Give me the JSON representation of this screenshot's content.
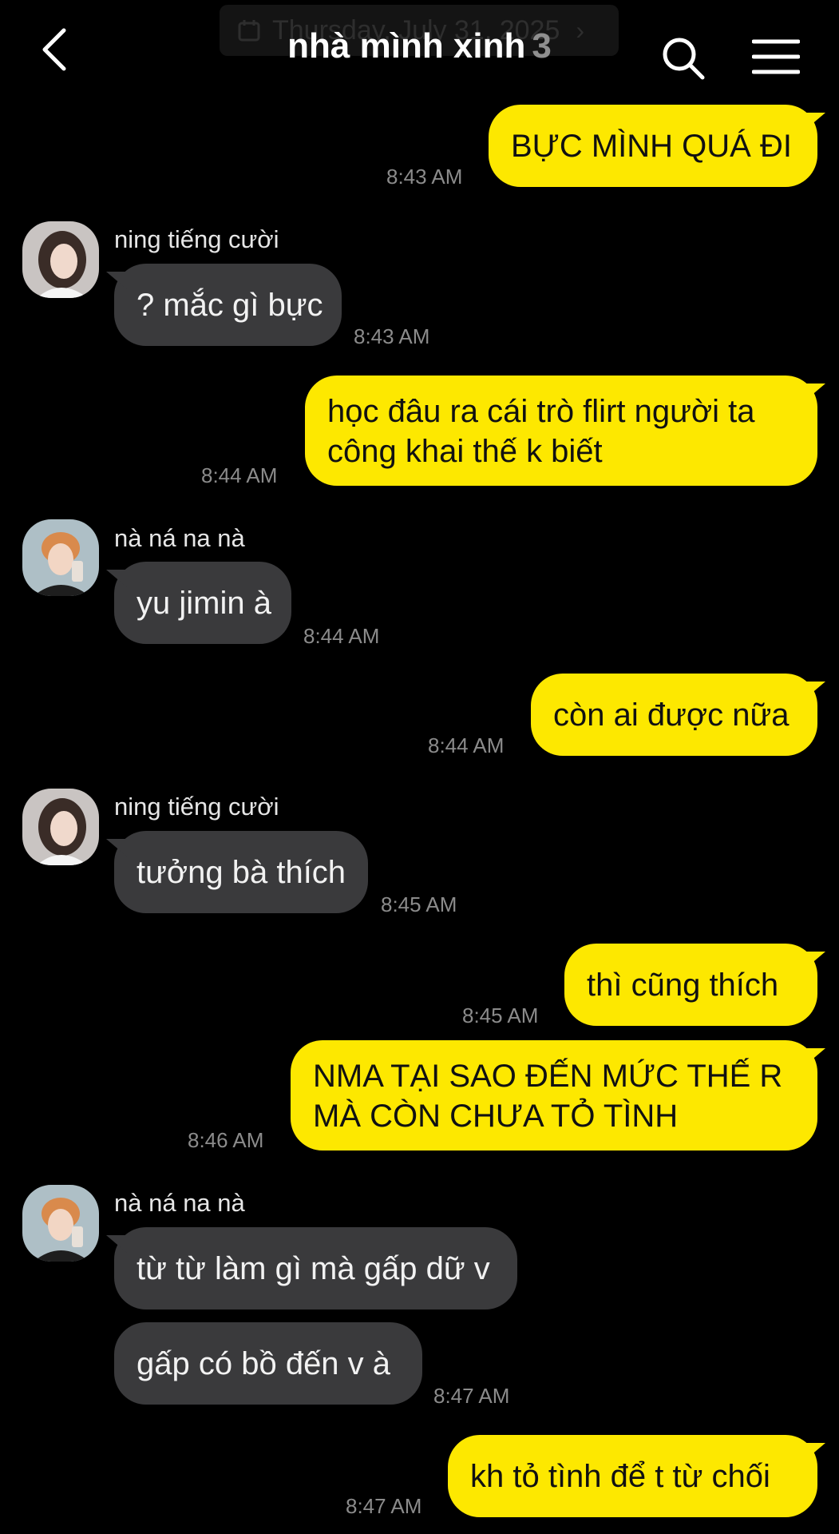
{
  "header": {
    "date_label": "Thursday, July 31, 2025",
    "chat_title": "nhà mình xinh",
    "member_count": "3"
  },
  "messages": [
    {
      "from": "me",
      "text": "BỰC MÌNH QUÁ ĐI",
      "time": "8:43 AM"
    },
    {
      "from": "ning tiếng cười",
      "text": "? mắc gì bực",
      "time": "8:43 AM"
    },
    {
      "from": "me",
      "text_lines": [
        "học đâu ra cái trò flirt người ta",
        "công khai thế k biết"
      ],
      "time": "8:44 AM"
    },
    {
      "from": "nà ná na nà",
      "text": "yu jimin à",
      "time": "8:44 AM"
    },
    {
      "from": "me",
      "text": "còn ai được nữa",
      "time": "8:44 AM"
    },
    {
      "from": "ning tiếng cười",
      "text": "tưởng bà thích",
      "time": "8:45 AM"
    },
    {
      "from": "me",
      "text": "thì cũng thích",
      "time": "8:45 AM"
    },
    {
      "from": "me",
      "text_lines": [
        "NMA TẠI SAO ĐẾN MỨC THẾ R",
        "MÀ CÒN CHƯA TỎ TÌNH"
      ],
      "time": "8:46 AM"
    },
    {
      "from": "nà ná na nà",
      "text": "từ từ làm gì mà gấp dữ v"
    },
    {
      "from": "nà ná na nà",
      "text": "gấp có bồ đến v à",
      "time": "8:47 AM"
    },
    {
      "from": "me",
      "text": "kh tỏ tình để t từ chối",
      "time": "8:47 AM"
    }
  ],
  "colors": {
    "my_bubble": "#fde800",
    "other_bubble": "#3a3a3c",
    "background": "#000000"
  }
}
